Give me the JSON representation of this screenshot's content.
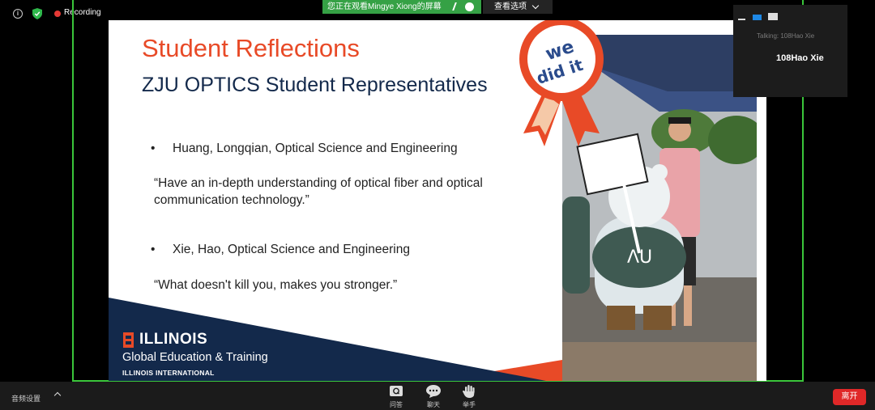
{
  "topbar": {
    "recording_label": "Recording",
    "share_banner": "您正在观看Mingye Xiong的屏幕",
    "view_options": "查看选项"
  },
  "slide": {
    "title": "Student Reflections",
    "subtitle": "ZJU OPTICS Student Representatives",
    "bullets": [
      "Huang, Longqian, Optical Science and Engineering",
      "Xie, Hao, Optical Science and Engineering"
    ],
    "quotes": [
      [
        "“Have an in-depth understanding of optical fiber and optical",
        "communication technology.”"
      ],
      [
        "“What doesn't kill you, makes you stronger.”"
      ]
    ],
    "badge_text": [
      "we",
      "did it"
    ],
    "logo": {
      "word": "ILLINOIS",
      "subtitle": "Global Education & Training",
      "subtitle2": "ILLINOIS INTERNATIONAL"
    },
    "colors": {
      "orange": "#e84a27",
      "navy": "#13294b"
    }
  },
  "talking_panel": {
    "label": "Talking: 108Hao Xie",
    "name": "108Hao Xie"
  },
  "toolbar": {
    "audio_settings": "音频设置",
    "items": [
      {
        "label": "问答",
        "icon": "qa-icon"
      },
      {
        "label": "聊天",
        "icon": "chat-icon"
      },
      {
        "label": "举手",
        "icon": "raise-hand-icon"
      }
    ],
    "leave_label": "离开"
  }
}
